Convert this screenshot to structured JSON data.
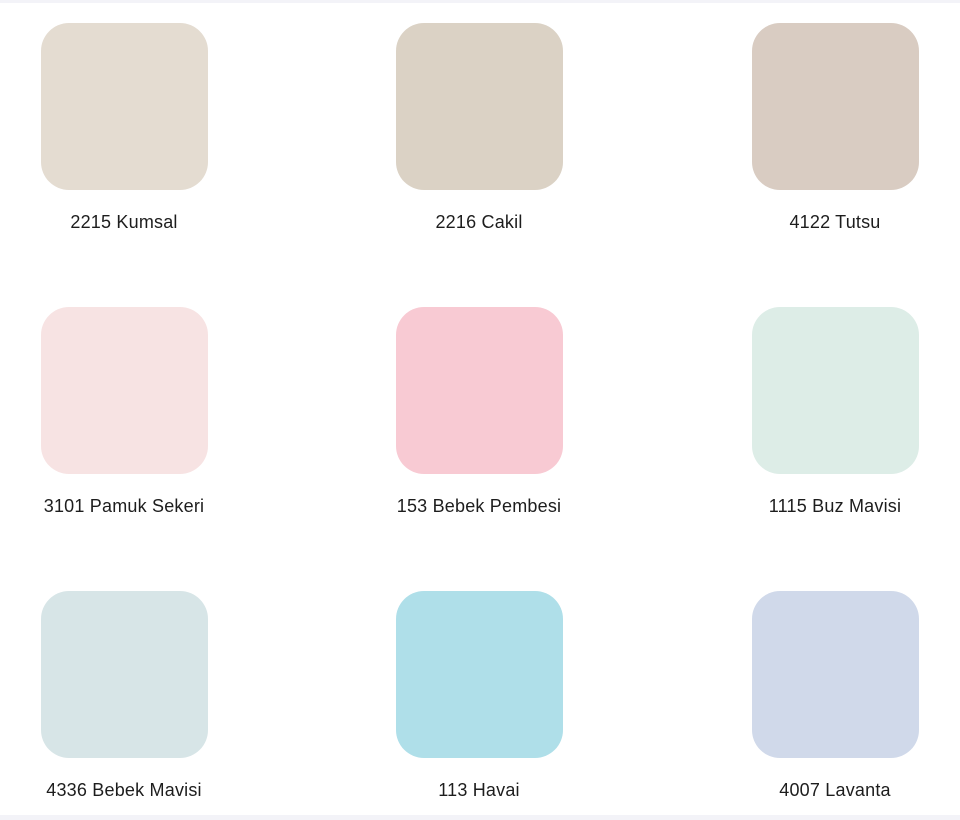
{
  "swatches": [
    {
      "name": "2215 Kumsal",
      "color": "#e4dcd1"
    },
    {
      "name": "2216 Cakil",
      "color": "#dbd2c5"
    },
    {
      "name": "4122 Tutsu",
      "color": "#d9ccc2"
    },
    {
      "name": "3101 Pamuk Sekeri",
      "color": "#f7e3e3"
    },
    {
      "name": "153 Bebek Pembesi",
      "color": "#f8cad3"
    },
    {
      "name": "1115 Buz Mavisi",
      "color": "#ddede7"
    },
    {
      "name": "4336 Bebek Mavisi",
      "color": "#d7e5e7"
    },
    {
      "name": "113 Havai",
      "color": "#afdfe9"
    },
    {
      "name": "4007 Lavanta",
      "color": "#d0d9ea"
    }
  ]
}
